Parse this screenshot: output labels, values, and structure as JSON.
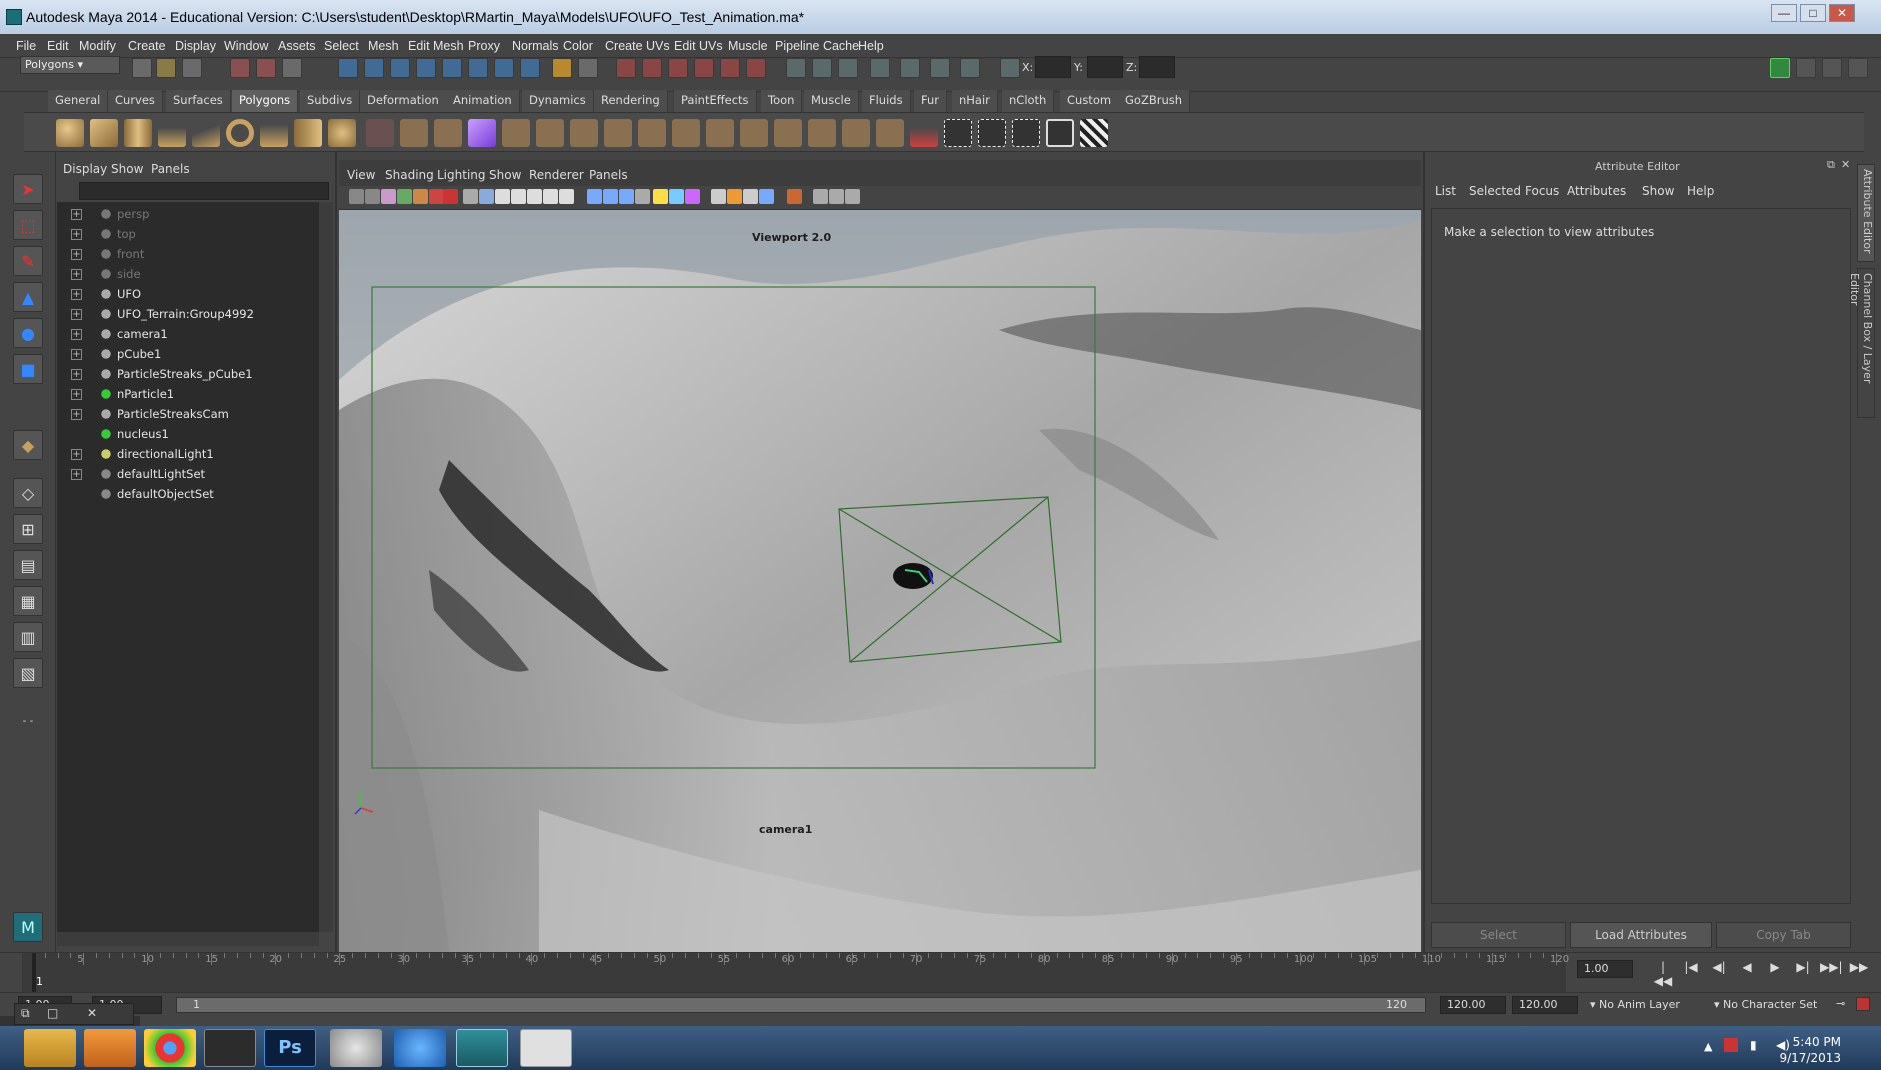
{
  "window": {
    "title": "Autodesk Maya 2014 - Educational Version: C:\\Users\\student\\Desktop\\RMartin_Maya\\Models\\UFO\\UFO_Test_Animation.ma*",
    "min": "—",
    "max": "□",
    "close": "✕"
  },
  "menubar": [
    "File",
    "Edit",
    "Modify",
    "Create",
    "Display",
    "Window",
    "Assets",
    "Select",
    "Mesh",
    "Edit Mesh",
    "Proxy",
    "Normals",
    "Color",
    "Create UVs",
    "Edit UVs",
    "Muscle",
    "Pipeline Cache",
    "Help"
  ],
  "status": {
    "mode": "Polygons",
    "x_label": "X:",
    "y_label": "Y:",
    "z_label": "Z:"
  },
  "shelf_tabs": [
    "General",
    "Curves",
    "Surfaces",
    "Polygons",
    "Subdivs",
    "Deformation",
    "Animation",
    "Dynamics",
    "Rendering",
    "PaintEffects",
    "Toon",
    "Muscle",
    "Fluids",
    "Fur",
    "nHair",
    "nCloth",
    "Custom",
    "GoZBrush"
  ],
  "shelf_active": "Polygons",
  "outliner": {
    "menu": [
      "Display",
      "Show",
      "Panels"
    ],
    "items": [
      {
        "label": "persp",
        "dim": true,
        "expand": true
      },
      {
        "label": "top",
        "dim": true,
        "expand": true
      },
      {
        "label": "front",
        "dim": true,
        "expand": true
      },
      {
        "label": "side",
        "dim": true,
        "expand": true
      },
      {
        "label": "UFO",
        "dim": false,
        "expand": true
      },
      {
        "label": "UFO_Terrain:Group4992",
        "dim": false,
        "expand": true
      },
      {
        "label": "camera1",
        "dim": false,
        "expand": true
      },
      {
        "label": "pCube1",
        "dim": false,
        "expand": true
      },
      {
        "label": "ParticleStreaks_pCube1",
        "dim": false,
        "expand": true
      },
      {
        "label": "nParticle1",
        "dim": false,
        "expand": true
      },
      {
        "label": "ParticleStreaksCam",
        "dim": false,
        "expand": true
      },
      {
        "label": "nucleus1",
        "dim": false,
        "expand": false
      },
      {
        "label": "directionalLight1",
        "dim": false,
        "expand": true
      },
      {
        "label": "defaultLightSet",
        "dim": false,
        "expand": true
      },
      {
        "label": "defaultObjectSet",
        "dim": false,
        "expand": false
      }
    ]
  },
  "viewport": {
    "menu": [
      "View",
      "Shading",
      "Lighting",
      "Show",
      "Renderer",
      "Panels"
    ],
    "renderer_label": "Viewport 2.0",
    "camera_label": "camera1"
  },
  "attribute_editor": {
    "title": "Attribute Editor",
    "menu": [
      "List",
      "Selected",
      "Focus",
      "Attributes",
      "Show",
      "Help"
    ],
    "message": "Make a selection to view attributes",
    "buttons": [
      "Select",
      "Load Attributes",
      "Copy Tab"
    ],
    "side_tabs": [
      "Attribute Editor",
      "Channel Box / Layer Editor"
    ]
  },
  "timeline": {
    "ticks": [
      "1",
      "5",
      "10",
      "15",
      "20",
      "25",
      "30",
      "35",
      "40",
      "45",
      "50",
      "55",
      "60",
      "65",
      "70",
      "75",
      "80",
      "85",
      "90",
      "95",
      "100",
      "105",
      "110",
      "115",
      "120"
    ],
    "current_frame": "1.00",
    "current_marker": "1"
  },
  "range": {
    "start_a": "1.00",
    "start_b": "1.00",
    "slider_start": "1",
    "slider_end": "120",
    "end_a": "120.00",
    "end_b": "120.00",
    "anim_layer": "No Anim Layer",
    "char_set": "No Character Set"
  },
  "playback": [
    "|◀◀",
    "|◀",
    "◀|",
    "◀",
    "▶",
    "▶|",
    "▶▶|",
    "▶▶"
  ],
  "taskbar": {
    "time": "5:40 PM",
    "date": "9/17/2013",
    "ps_label": "Ps"
  }
}
